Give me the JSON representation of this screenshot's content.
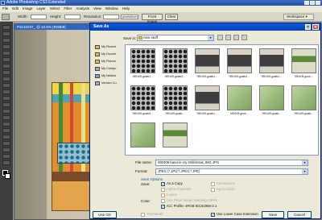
{
  "app": {
    "title": "Adobe Photoshop CS3 Extended",
    "menu": [
      "File",
      "Edit",
      "Image",
      "Layer",
      "Select",
      "Filter",
      "Analysis",
      "View",
      "Window",
      "Help"
    ]
  },
  "options_bar": {
    "width_label": "Width:",
    "height_label": "Height:",
    "resolution_label": "Resolution:",
    "resolution_unit": "pixels/inch",
    "front_image": "Front Image",
    "clear": "Clear",
    "workspace": "Workspace ▾"
  },
  "document": {
    "title": "P3132237_ @ 12.5% (RGB/8)"
  },
  "dialog": {
    "title": "Save As",
    "help_glyph": "?",
    "close_glyph": "✕",
    "save_in_label": "Save in:",
    "save_in_value": "new stuff",
    "places": [
      {
        "label": "My Recent",
        "color": "#e8c14a"
      },
      {
        "label": "My Docum",
        "color": "#e8c14a"
      },
      {
        "label": "My Picture",
        "color": "#e8c14a"
      },
      {
        "label": "My Compu",
        "color": "#9fb3c8"
      },
      {
        "label": "My Networ",
        "color": "#7ba6d6"
      },
      {
        "label": "Version Cu",
        "color": "#9fb3c8"
      }
    ],
    "files": [
      {
        "caption": "090105-goals1…",
        "tex": "tex-dots"
      },
      {
        "caption": "090105-goals3…",
        "tex": "tex-dots"
      },
      {
        "caption": "090105-goals1…",
        "tex": "tex-card"
      },
      {
        "caption": "090105-goals4…",
        "tex": "tex-card"
      },
      {
        "caption": "090105-goals1…",
        "tex": "tex-card"
      },
      {
        "caption": "090105-grow…",
        "tex": "tex-grow"
      },
      {
        "caption": "090105-goals3…",
        "tex": "tex-dots"
      },
      {
        "caption": "090105-goals…",
        "tex": "tex-dots"
      },
      {
        "caption": "090105-goals1…",
        "tex": "tex-card"
      },
      {
        "caption": "090105-grow…",
        "tex": "tex-green"
      },
      {
        "caption": "090105-goals…",
        "tex": "tex-green"
      },
      {
        "caption": "090105-goals…",
        "tex": "tex-green"
      },
      {
        "caption": "",
        "tex": "tex-green"
      },
      {
        "caption": "",
        "tex": "tex-grow"
      }
    ],
    "file_name_label": "File name:",
    "file_name_value": "090309-hand-in-cry-Onlinkmat_IMG.JPG",
    "format_label": "Format:",
    "format_value": "JPEG (*.JPG;*.JPEG;*.JPE)",
    "save_options_title": "Save Options",
    "save_label": "Save:",
    "opts": {
      "as_copy": "As a Copy",
      "annotations": "Annotations",
      "alpha": "Alpha Channels",
      "spot": "Spot Colors",
      "layers": "Layers"
    },
    "color_label": "Color:",
    "proof_setup": "Use Proof Setup: Working CMYK",
    "icc_profile": "ICC Profile: sRGB IEC61966-2.1",
    "thumbnail": "Thumbnail",
    "lowercase_ext": "Use Lower Case Extension",
    "use_os_dialog": "Use OS Dialog",
    "save_button": "Save",
    "cancel_button": "Cancel",
    "check_glyph": "✓",
    "arrow_glyph": "▾"
  }
}
